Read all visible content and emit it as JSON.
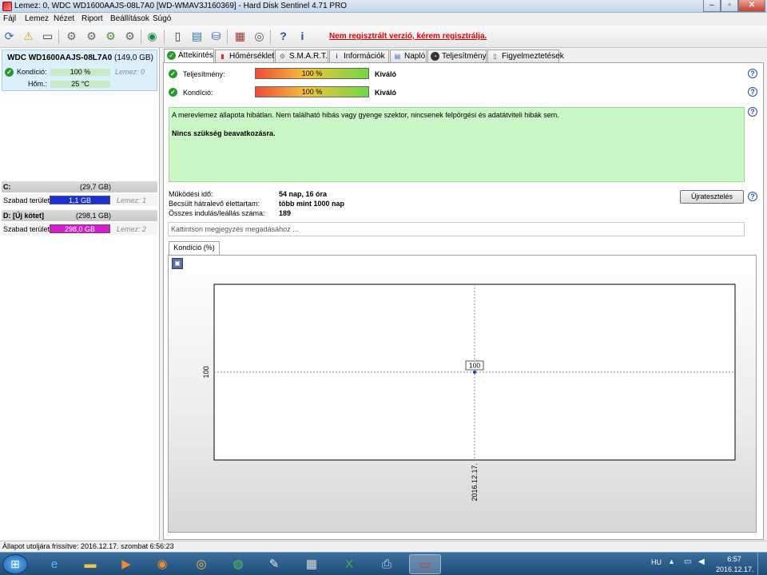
{
  "window": {
    "title": "Lemez: 0, WDC WD1600AAJS-08L7A0 [WD-WMAV3J160369]  -  Hard Disk Sentinel 4.71 PRO",
    "controls": {
      "minimize": "–",
      "maximize": "▫",
      "close": "✕"
    }
  },
  "menu": [
    "Fájl",
    "Lemez",
    "Nézet",
    "Riport",
    "Beállítások",
    "Súgó"
  ],
  "toolbar": {
    "icons": [
      "refresh-icon",
      "warning-icon",
      "report-icon",
      "disk-tool-1-icon",
      "disk-tool-2-icon",
      "disk-tool-3-icon",
      "disk-tool-4-icon",
      "globe-icon",
      "copy-icon",
      "document-icon",
      "network-icon",
      "chart-icon",
      "settings-icon",
      "help-icon",
      "info-icon"
    ],
    "registration_text": "Nem regisztrált verzió, kérem regisztrálja."
  },
  "left": {
    "disk": {
      "name": "WDC WD1600AAJS-08L7A0",
      "size": "(149,0 GB)",
      "condition_label": "Kondíció:",
      "condition_value": "100 %",
      "condition_level": 100,
      "disk_index": "Lemez: 0",
      "temp_label": "Hőm.:",
      "temp_value": "25 °C"
    },
    "partitions": [
      {
        "name": "C:",
        "size": "(29,7 GB)",
        "free_label": "Szabad terület",
        "free_value": "1,1 GB",
        "color": "#1a2fd6",
        "disk": "Lemez: 1"
      },
      {
        "name": "D: [Új kötet]",
        "size": "(298,1 GB)",
        "free_label": "Szabad terület",
        "free_value": "298,0 GB",
        "color": "#d81ad0",
        "disk": "Lemez: 2"
      }
    ]
  },
  "tabs": [
    "Áttekintés",
    "Hőmérséklet",
    "S.M.A.R.T.",
    "Információk",
    "Napló",
    "Teljesítmény",
    "Figyelmeztetések"
  ],
  "overview": {
    "performance": {
      "label": "Teljesítmény:",
      "value": "100 %",
      "level": 100,
      "rating": "Kiváló"
    },
    "condition": {
      "label": "Kondíció:",
      "value": "100 %",
      "level": 100,
      "rating": "Kiváló"
    },
    "status_text": "A merevlemez állapota hibátlan. Nem található hibás vagy gyenge szektor, nincsenek felpörgési és adatátviteli hibák sem.",
    "status_recommendation": "Nincs szükség beavatkozásra.",
    "uptime_label": "Működési idő:",
    "uptime_value": "54 nap, 16 óra",
    "remaining_label": "Becsült hátralevő élettartam:",
    "remaining_value": "több mint 1000 nap",
    "starts_label": "Összes indulás/leállás száma:",
    "starts_value": "189",
    "restart_button": "Újratesztelés",
    "note_placeholder": "Kattintson megjegyzés megadásához ..."
  },
  "chart_tab_label": "Kondíció  (%)",
  "chart_data": {
    "type": "line",
    "x": [
      "2016.12.17."
    ],
    "series": [
      {
        "values": [
          100
        ]
      }
    ],
    "point_labels": [
      "100"
    ],
    "y_tick_labels": [
      "100"
    ],
    "x_tick_labels": [
      "2016.12.17."
    ],
    "grid": true
  },
  "statusbar": "Állapot utoljára frissítve: 2016.12.17. szombat 6:56:23",
  "taskbar": {
    "apps": [
      "ie-icon",
      "explorer-icon",
      "media-player-icon",
      "firefox-icon",
      "chrome-icon",
      "media-center-icon",
      "paint-icon",
      "calculator-icon",
      "excel-icon",
      "network-printer-icon",
      "hd-sentinel-icon"
    ],
    "language": "HU",
    "time": "6:57",
    "date": "2016.12.17."
  }
}
